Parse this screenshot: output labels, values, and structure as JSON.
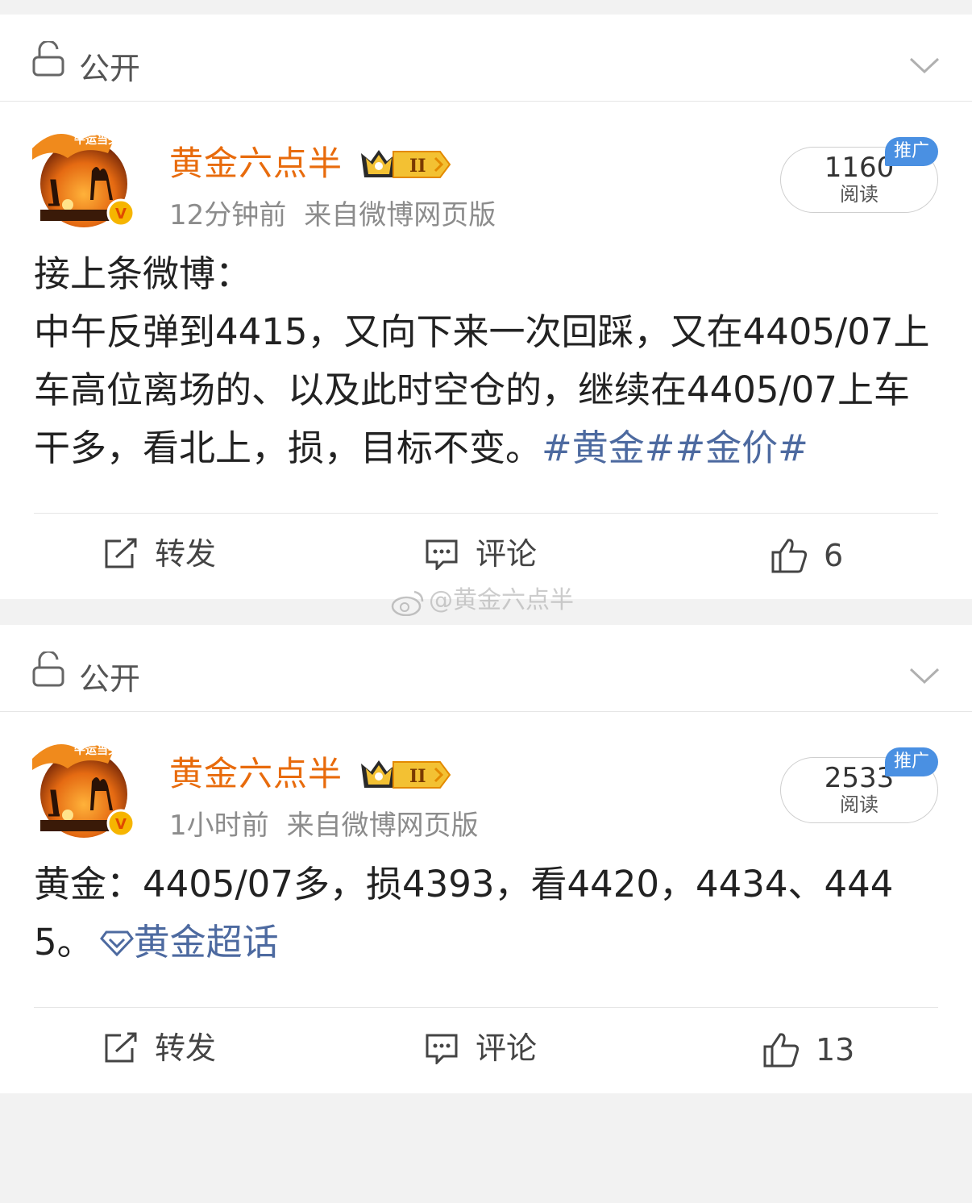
{
  "posts": [
    {
      "visibility": "公开",
      "author": "黄金六点半",
      "time": "12分钟前",
      "source": "来自微博网页版",
      "reads": {
        "count": "1160",
        "label": "阅读",
        "tag": "推广"
      },
      "text": {
        "line1": "接上条微博：",
        "line2": "中午反弹到4415，又向下来一次回踩，又在4405/07上车高位离场的、以及此时空仓的，继续在4405/07上车干多，看北上，损，目标不变。",
        "tag1": "#黄金#",
        "tag2": "#金价#"
      },
      "actions": {
        "repost": "转发",
        "comment": "评论",
        "likes": "6"
      }
    },
    {
      "visibility": "公开",
      "author": "黄金六点半",
      "time": "1小时前",
      "source": "来自微博网页版",
      "reads": {
        "count": "2533",
        "label": "阅读",
        "tag": "推广"
      },
      "text": {
        "line1": "黄金：4405/07多，损4393，看4420，4434、4445。",
        "topic": "黄金超话"
      },
      "actions": {
        "repost": "转发",
        "comment": "评论",
        "likes": "13"
      }
    }
  ],
  "watermark": "@黄金六点半",
  "colors": {
    "author": "#e86b0c",
    "link": "#4d6aa0",
    "promo": "#4a90e2"
  }
}
